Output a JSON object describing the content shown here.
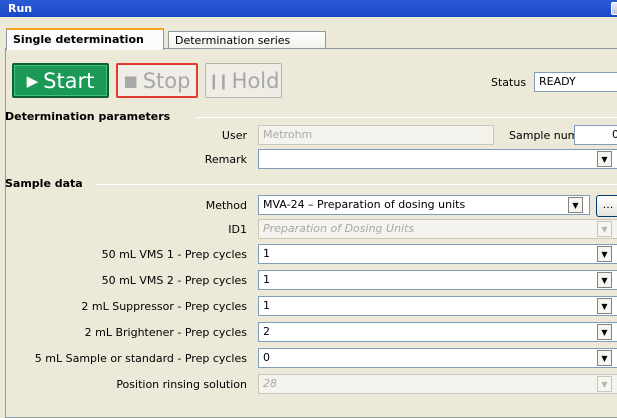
{
  "window": {
    "title": "Run"
  },
  "tabs": [
    {
      "label": "Single determination",
      "active": true
    },
    {
      "label": "Determination series",
      "active": false
    }
  ],
  "controls": {
    "start": "Start",
    "stop": "Stop",
    "hold": "Hold",
    "start_icon": "play-icon",
    "stop_icon": "stop-square-icon",
    "hold_icon": "pause-icon",
    "start_color": "#1b9a57",
    "stop_border_color": "#e03a33"
  },
  "status": {
    "label": "Status",
    "value": "READY"
  },
  "determination_parameters": {
    "heading": "Determination parameters",
    "user_label": "User",
    "user_value": "Metrohm",
    "sample_number_label": "Sample number",
    "sample_number_value": "0",
    "remark_label": "Remark",
    "remark_value": ""
  },
  "sample_data": {
    "heading": "Sample data",
    "method_label": "Method",
    "method_value": "MVA-24 – Preparation of dosing units",
    "method_browse": "...",
    "id1_label": "ID1",
    "id1_value": "Preparation of Dosing Units",
    "rows": [
      {
        "label": "50 mL VMS 1 - Prep cycles",
        "value": "1"
      },
      {
        "label": "50 mL VMS 2 - Prep cycles",
        "value": "1"
      },
      {
        "label": "2 mL Suppressor - Prep cycles",
        "value": "1"
      },
      {
        "label": "2 mL Brightener - Prep cycles",
        "value": "2"
      },
      {
        "label": "5 mL Sample or standard - Prep cycles",
        "value": "0"
      }
    ],
    "rinsing_label": "Position rinsing solution",
    "rinsing_value": "28"
  }
}
